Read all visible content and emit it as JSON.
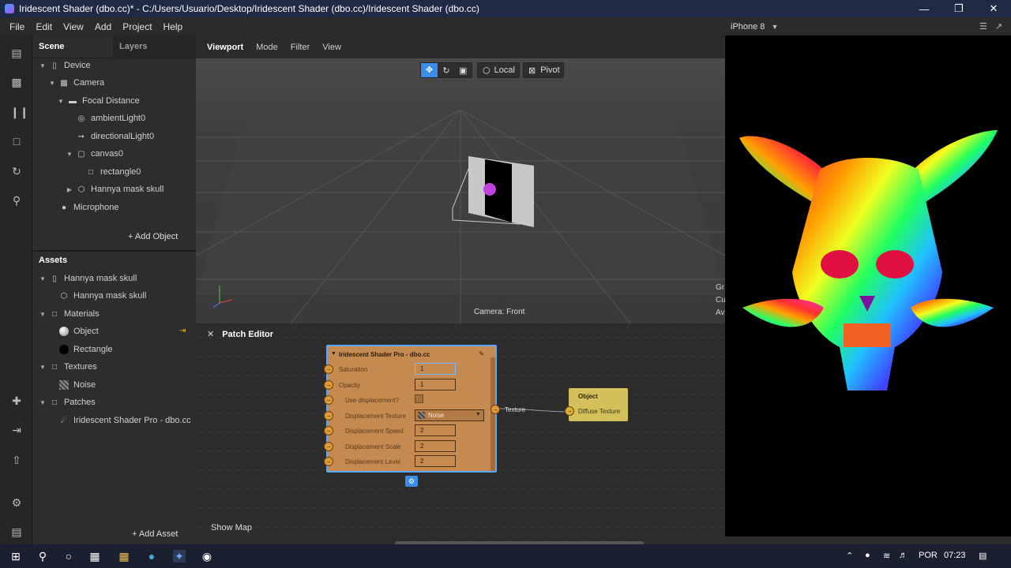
{
  "title": "Iridescent Shader (dbo.cc)* - C:/Users/Usuario/Desktop/Iridescent Shader (dbo.cc)/Iridescent Shader (dbo.cc)",
  "menu": [
    "File",
    "Edit",
    "View",
    "Add",
    "Project",
    "Help"
  ],
  "device": "iPhone 8",
  "scene_tabs": {
    "scene": "Scene",
    "layers": "Layers"
  },
  "scene_tree": [
    {
      "label": "Device"
    },
    {
      "label": "Camera"
    },
    {
      "label": "Focal Distance"
    },
    {
      "label": "ambientLight0"
    },
    {
      "label": "directionalLight0"
    },
    {
      "label": "canvas0"
    },
    {
      "label": "rectangle0"
    },
    {
      "label": "Hannya mask skull"
    },
    {
      "label": "Microphone"
    }
  ],
  "add_object": "Add Object",
  "assets_title": "Assets",
  "assets_tree": [
    {
      "label": "Hannya mask skull"
    },
    {
      "label": "Hannya mask skull"
    },
    {
      "label": "Materials"
    },
    {
      "label": "Object"
    },
    {
      "label": "Rectangle"
    },
    {
      "label": "Textures"
    },
    {
      "label": "Noise"
    },
    {
      "label": "Patches"
    },
    {
      "label": "Iridescent Shader Pro - dbo.cc"
    }
  ],
  "add_asset": "Add Asset",
  "viewport_tabs": [
    "Viewport",
    "Mode",
    "Filter",
    "View"
  ],
  "viewport_tools": {
    "local": "Local",
    "pivot": "Pivot"
  },
  "camera_label": "Camera: Front",
  "viewport_edge": [
    "Gr",
    "Cu",
    "Av"
  ],
  "patch_editor": {
    "title": "Patch Editor",
    "show_map": "Show Map",
    "node_title": "Iridescent Shader Pro - dbo.cc",
    "rows": [
      {
        "label": "Saturation",
        "value": "1"
      },
      {
        "label": "Opacity",
        "value": "1"
      },
      {
        "label": "Use displacement?",
        "value": ""
      },
      {
        "label": "Displacement Texture",
        "value": "Noise"
      },
      {
        "label": "Displacement Speed",
        "value": "2"
      },
      {
        "label": "Displacement Scale",
        "value": "2"
      },
      {
        "label": "Displacement Level",
        "value": "2"
      }
    ],
    "output_label": "Texture",
    "object_node": {
      "title": "Object",
      "input": "Diffuse Texture"
    }
  },
  "taskbar": {
    "lang": "POR",
    "time": "07:23"
  }
}
